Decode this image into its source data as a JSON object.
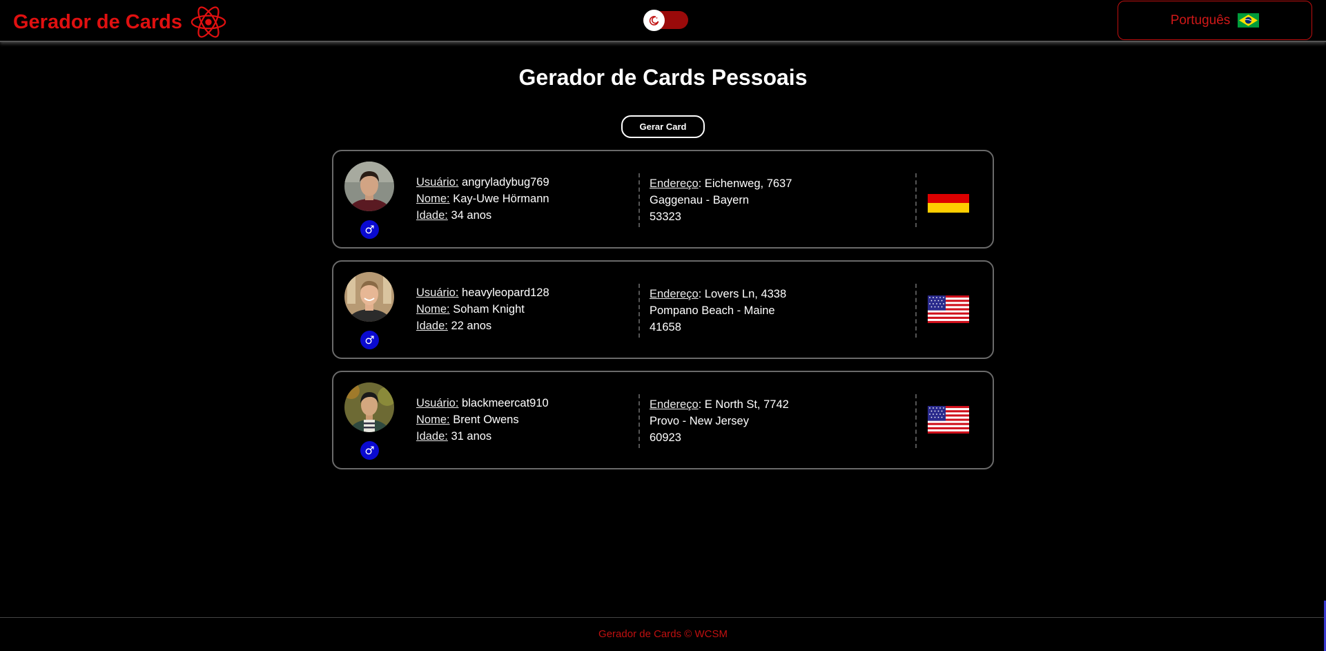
{
  "header": {
    "brand_title": "Gerador de Cards",
    "brand_icon": "react-icon",
    "theme_toggle_icon": "moon-icon",
    "language": {
      "label": "Português",
      "flag": "brazil-flag-icon"
    }
  },
  "main": {
    "title": "Gerador de Cards Pessoais",
    "generate_button": "Gerar Card"
  },
  "labels": {
    "username": "Usuário:",
    "name": "Nome:",
    "age": "Idade:",
    "address": "Endereço"
  },
  "cards": [
    {
      "username": "angryladybug769",
      "name": "Kay-Uwe Hörmann",
      "age": "34 anos",
      "address_line1": ": Eichenweg, 7637",
      "address_line2": "Gaggenau - Bayern",
      "postcode": "53323",
      "gender_icon": "male-icon",
      "flag": "germany-flag-icon"
    },
    {
      "username": "heavyleopard128",
      "name": "Soham Knight",
      "age": "22 anos",
      "address_line1": ": Lovers Ln, 4338",
      "address_line2": "Pompano Beach - Maine",
      "postcode": "41658",
      "gender_icon": "male-icon",
      "flag": "usa-flag-icon"
    },
    {
      "username": "blackmeercat910",
      "name": "Brent Owens",
      "age": "31 anos",
      "address_line1": ": E North St, 7742",
      "address_line2": "Provo - New Jersey",
      "postcode": "60923",
      "gender_icon": "male-icon",
      "flag": "usa-flag-icon"
    }
  ],
  "footer": {
    "text": "Gerador de Cards © WCSM"
  },
  "colors": {
    "accent": "#e01010",
    "background": "#000000",
    "gender_male": "#0a0ad0",
    "toggle_track": "#9a0a0a"
  }
}
